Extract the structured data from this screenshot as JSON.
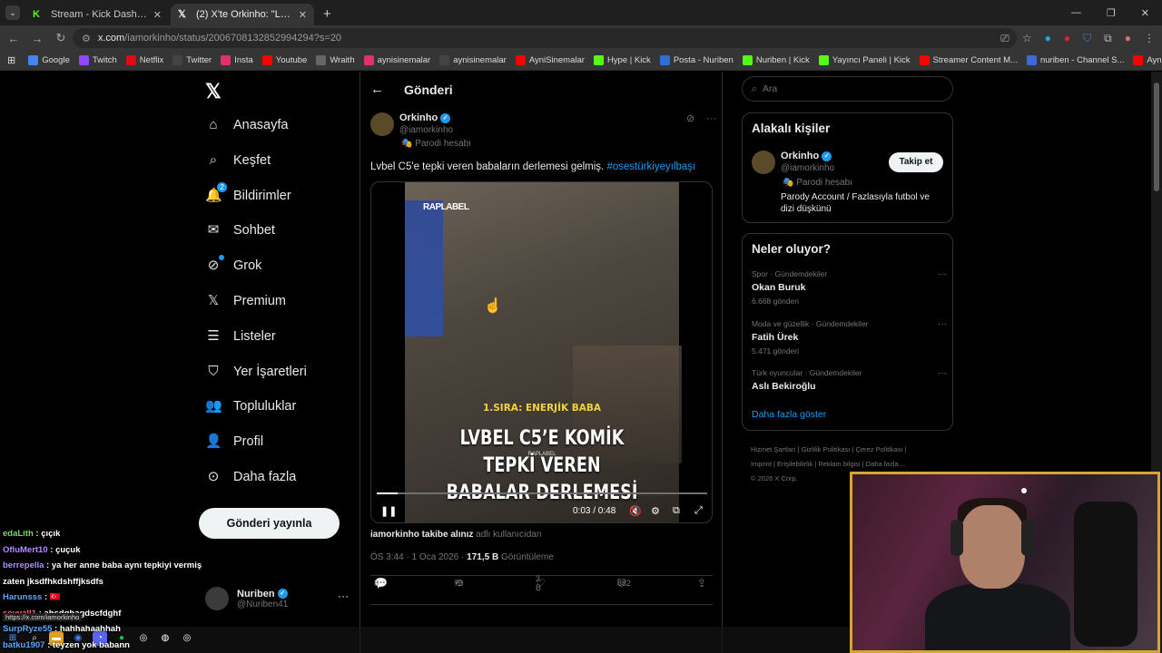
{
  "browser": {
    "tabs": [
      {
        "label": "Stream - Kick Dashboard",
        "icon": "kick-icon",
        "color": "#53fc18"
      },
      {
        "label": "(2) X'te Orkinho: \"Lvbel C5'e tep",
        "icon": "x-icon",
        "color": "#ffffff"
      }
    ],
    "url_domain": "x.com",
    "url_path": "/iamorkinho/status/2006708132852994294?s=20",
    "bookmarks": [
      {
        "label": "Google",
        "icon": "google-icon",
        "color": "#4285f4"
      },
      {
        "label": "Twitch",
        "icon": "twitch-icon",
        "color": "#9146ff"
      },
      {
        "label": "Netflix",
        "icon": "netflix-icon",
        "color": "#e50914"
      },
      {
        "label": "Twitter",
        "icon": "x-icon",
        "color": "#444444"
      },
      {
        "label": "Insta",
        "icon": "instagram-icon",
        "color": "#e1306c"
      },
      {
        "label": "Youtube",
        "icon": "youtube-icon",
        "color": "#ff0000"
      },
      {
        "label": "Wraith",
        "icon": "wraith-icon",
        "color": "#666666"
      },
      {
        "label": "aynisinemalar",
        "icon": "instagram-icon",
        "color": "#e1306c"
      },
      {
        "label": "aynisinemalar",
        "icon": "x-icon",
        "color": "#444444"
      },
      {
        "label": "AyniSinemalar",
        "icon": "youtube-icon",
        "color": "#ff0000"
      },
      {
        "label": "Hype | Kick",
        "icon": "kick-icon",
        "color": "#53fc18"
      },
      {
        "label": "Posta - Nuriben",
        "icon": "mail-icon",
        "color": "#2f6fd6"
      },
      {
        "label": "Nuriben | Kick",
        "icon": "kick-icon",
        "color": "#53fc18"
      },
      {
        "label": "Yayıncı Paneli | Kick",
        "icon": "kick-icon",
        "color": "#53fc18"
      },
      {
        "label": "Streamer Content M...",
        "icon": "youtube-icon",
        "color": "#ff0000"
      },
      {
        "label": "nuriben - Channel S...",
        "icon": "channel-icon",
        "color": "#3d6ad6"
      },
      {
        "label": "Aynı Sinemalar - Ça...",
        "icon": "youtube-icon",
        "color": "#ff0000"
      }
    ]
  },
  "x": {
    "logo": "𝕏",
    "nav": [
      {
        "label": "Anasayfa",
        "icon": "home-icon",
        "glyph": "⌂"
      },
      {
        "label": "Keşfet",
        "icon": "search-icon",
        "glyph": "⌕"
      },
      {
        "label": "Bildirimler",
        "icon": "bell-icon",
        "glyph": "🔔",
        "badge": "2"
      },
      {
        "label": "Sohbet",
        "icon": "mail-icon",
        "glyph": "✉"
      },
      {
        "label": "Grok",
        "icon": "grok-icon",
        "glyph": "⊘"
      },
      {
        "label": "Premium",
        "icon": "x-icon",
        "glyph": "𝕏"
      },
      {
        "label": "Listeler",
        "icon": "list-icon",
        "glyph": "☰"
      },
      {
        "label": "Yer İşaretleri",
        "icon": "bookmark-icon",
        "glyph": "⛉"
      },
      {
        "label": "Topluluklar",
        "icon": "people-icon",
        "glyph": "👥"
      },
      {
        "label": "Profil",
        "icon": "user-icon",
        "glyph": "👤"
      },
      {
        "label": "Daha fazla",
        "icon": "more-circle-icon",
        "glyph": "⊙"
      }
    ],
    "post_button": "Gönderi yayınla",
    "account": {
      "name": "Nuriben",
      "handle": "@Nuriben41"
    },
    "header_title": "Gönderi",
    "tweet": {
      "name": "Orkinho",
      "handle": "@iamorkinho",
      "parody": "Parodi hesabı",
      "text": "Lvbel C5'e tepki veren babaların derlemesi gelmiş.",
      "hashtag": "#osestürkiyeyılbaşı",
      "video": {
        "logo": "RAPLABEL",
        "rank": "1.SIRA: ENERJİK BABA",
        "title_line1": "LVBEL C5’E KOMİK TEPKİ VEREN",
        "title_line2": "BABALAR DERLEMESİ",
        "watermark": "RAPLABEL",
        "time": "0:03 / 0:48",
        "progress": 0.0625
      },
      "caption_bold": "iamorkinho takibe alınız",
      "caption_sub": "adlı kullanıcıdan",
      "time": "ÖS 3:44 · 1 Oca 2026 · ",
      "views": "171,5 B",
      "views_label": "Görüntüleme",
      "replies": "8",
      "retweets": "78",
      "likes": "3 B",
      "bookmarks": "882"
    },
    "search_placeholder": "Ara",
    "related": {
      "title": "Alakalı kişiler",
      "name": "Orkinho",
      "handle": "@iamorkinho",
      "parody": "Parodi hesabı",
      "bio": "Parody Account / Fazlasıyla futbol ve dizi düşkünü",
      "follow": "Takip et"
    },
    "trends": {
      "title": "Neler oluyor?",
      "items": [
        {
          "category": "Spor · Gündemdekiler",
          "title": "Okan Buruk",
          "count": "6.668 gönderi"
        },
        {
          "category": "Moda ve güzellik · Gündemdekiler",
          "title": "Fatih Ürek",
          "count": "5.471 gönderi"
        },
        {
          "category": "Türk oyuncular · Gündemdekiler",
          "title": "Aslı Bekiroğlu",
          "count": ""
        }
      ],
      "show_more": "Daha fazla göster"
    },
    "footer": {
      "line1": "Hizmet Şartları  |  Gizlilik Politikası  |  Çerez Politikası  |",
      "line2": "Imprint  |  Erişilebilirlik  |  Reklam bilgisi  |  Daha fazla ...",
      "line3": "© 2026 X Corp."
    }
  },
  "chat": [
    {
      "user": "edaLith",
      "color": "#7cd66b",
      "msg": " : çıçık"
    },
    {
      "user": "OfluMert10",
      "color": "#b28cff",
      "msg": " : çuçuk"
    },
    {
      "user": "berrepella",
      "color": "#b28cff",
      "msg": " : ya her anne baba aynı tepkiyi vermiş zaten jksdfhkdshffjksdfs"
    },
    {
      "user": "Harunsss",
      "color": "#5aa7ff",
      "msg": " : 🇹🇷"
    },
    {
      "user": "sevvall1",
      "color": "#ff6a6a",
      "msg": " : ahsdghagdscfdghf"
    },
    {
      "user": "SurpRyze55",
      "color": "#5aa7ff",
      "msg": " : hahhahaahhah"
    },
    {
      "user": "batku1907",
      "color": "#5aa7ff",
      "msg": " : teyzen yok babann"
    }
  ],
  "status_url": "https://x.com/iamorkinho"
}
